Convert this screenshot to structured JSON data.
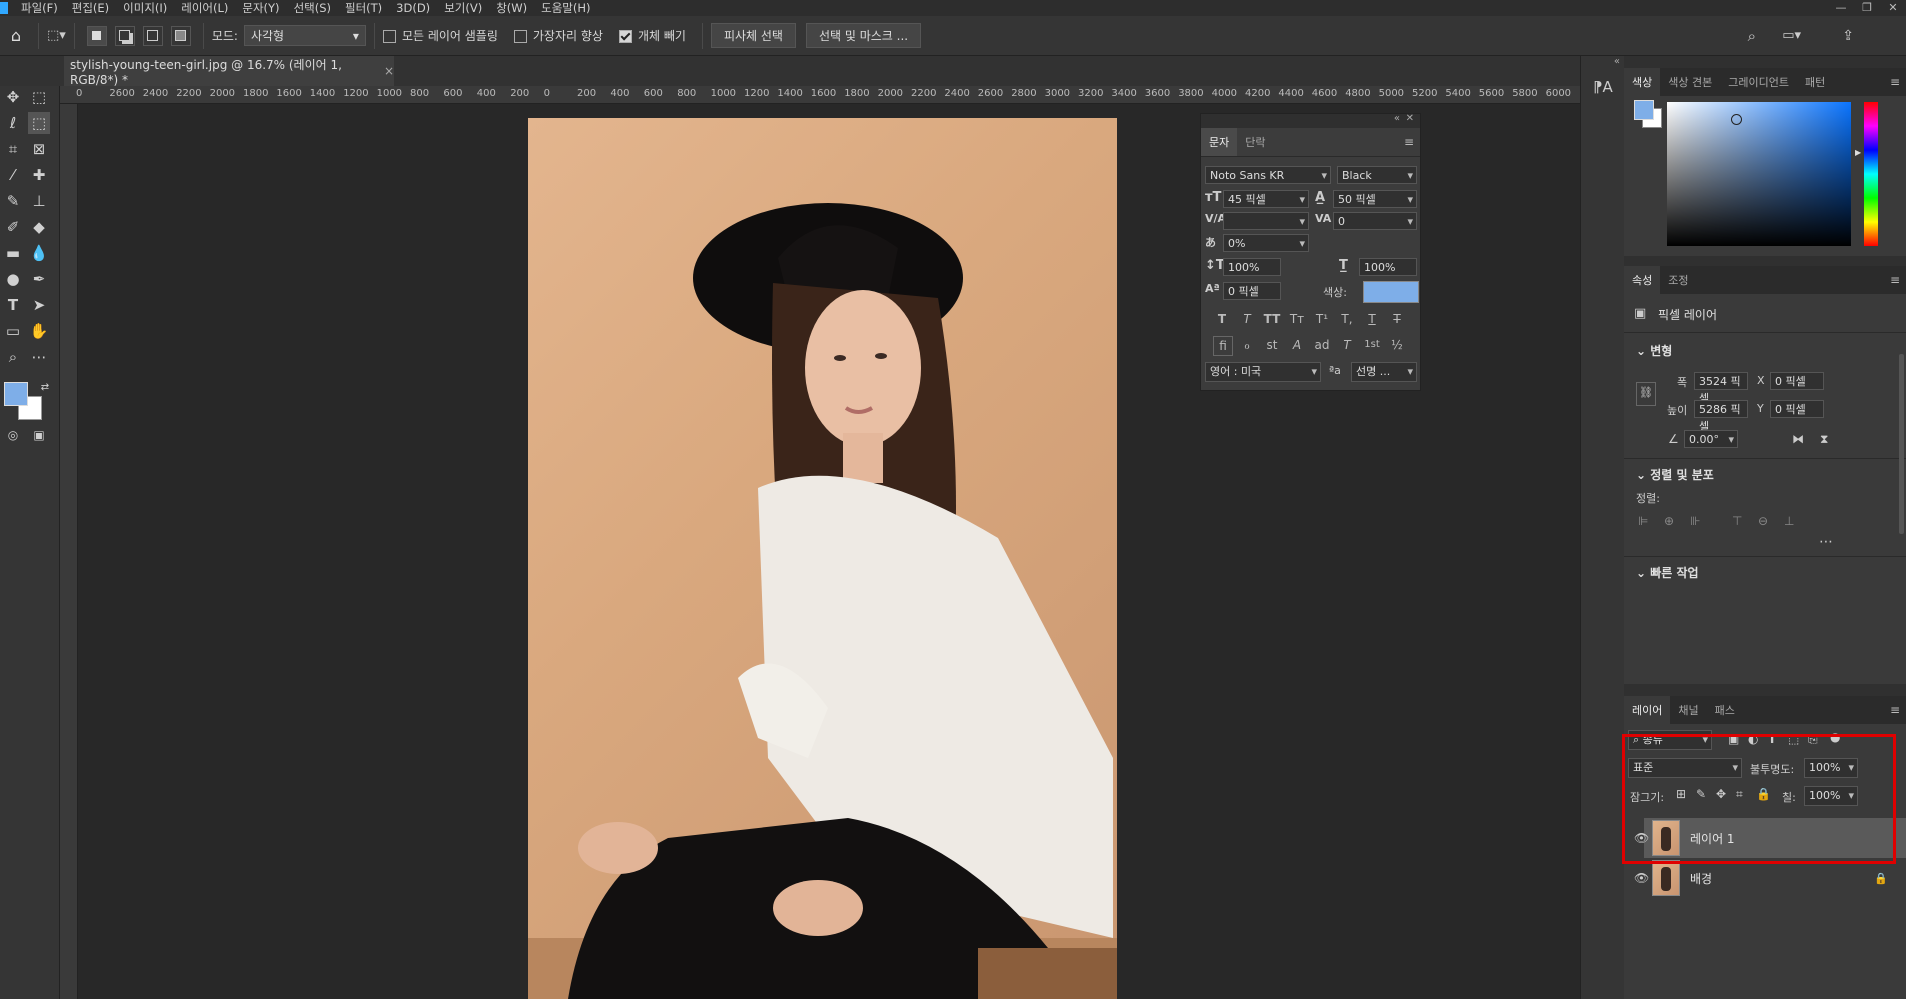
{
  "menubar": {
    "items": [
      "파일(F)",
      "편집(E)",
      "이미지(I)",
      "레이어(L)",
      "문자(Y)",
      "선택(S)",
      "필터(T)",
      "3D(D)",
      "보기(V)",
      "창(W)",
      "도움말(H)"
    ]
  },
  "options": {
    "mode_label": "모드:",
    "mode_value": "사각형",
    "sample_all_layers": "모든 레이어 샘플링",
    "enhance_edge": "가장자리 향상",
    "object_subtract": "개체 빼기",
    "select_subject": "피사체 선택",
    "select_and_mask": "선택 및 마스크 ..."
  },
  "document": {
    "tab_title": "stylish-young-teen-girl.jpg @ 16.7% (레이어 1, RGB/8*) *",
    "close": "×"
  },
  "ruler": {
    "labels": [
      "0",
      "2600",
      "2400",
      "2200",
      "2000",
      "1800",
      "1600",
      "1400",
      "1200",
      "1000",
      "800",
      "600",
      "400",
      "200",
      "0",
      "200",
      "400",
      "600",
      "800",
      "1000",
      "1200",
      "1400",
      "1600",
      "1800",
      "2000",
      "2200",
      "2400",
      "2600",
      "2800",
      "3000",
      "3200",
      "3400",
      "3600",
      "3800",
      "4000",
      "4200",
      "4400",
      "4600",
      "4800",
      "5000",
      "5200",
      "5400",
      "5600",
      "5800",
      "6000"
    ]
  },
  "character_panel": {
    "tab_char": "문자",
    "tab_para": "단락",
    "font_family": "Noto Sans KR",
    "font_style": "Black",
    "font_size": "45 픽셀",
    "leading": "50 픽셀",
    "kerning": "",
    "tracking": "0",
    "tsume": "0%",
    "vscale": "100%",
    "hscale": "100%",
    "baseline": "0 픽셀",
    "color_label": "색상:",
    "language": "영어 : 미국",
    "antialias": "선명 ...",
    "style_buttons": [
      "T",
      "T",
      "TT",
      "Tт",
      "T¹",
      "T,",
      "T",
      "T"
    ],
    "ot_buttons": [
      "fi",
      "ℴ",
      "st",
      "A",
      "ad",
      "T",
      "1st",
      "½"
    ]
  },
  "color_panel": {
    "tabs": [
      "색상",
      "색상 견본",
      "그레이디언트",
      "패턴"
    ],
    "fg_color": "#7eaee8",
    "bg_color": "#ffffff"
  },
  "properties_panel": {
    "tabs": [
      "속성",
      "조정"
    ],
    "layer_type": "픽셀 레이어",
    "transform_title": "변형",
    "w_label": "폭",
    "w_value": "3524 픽셀",
    "x_label": "X",
    "x_value": "0 픽셀",
    "h_label": "높이",
    "h_value": "5286 픽셀",
    "y_label": "Y",
    "y_value": "0 픽셀",
    "angle_value": "0.00°",
    "align_title": "정렬 및 분포",
    "align_label": "정렬:",
    "quick_title": "빠른 작업"
  },
  "layers_panel": {
    "tabs": [
      "레이어",
      "채널",
      "패스"
    ],
    "filter_label": "종류",
    "blend_mode": "표준",
    "opacity_label": "불투명도:",
    "opacity_value": "100%",
    "lock_label": "잠그기:",
    "fill_label": "칠:",
    "fill_value": "100%",
    "layers": [
      {
        "name": "레이어 1",
        "selected": true,
        "locked": false
      },
      {
        "name": "배경",
        "selected": false,
        "locked": true
      }
    ]
  }
}
